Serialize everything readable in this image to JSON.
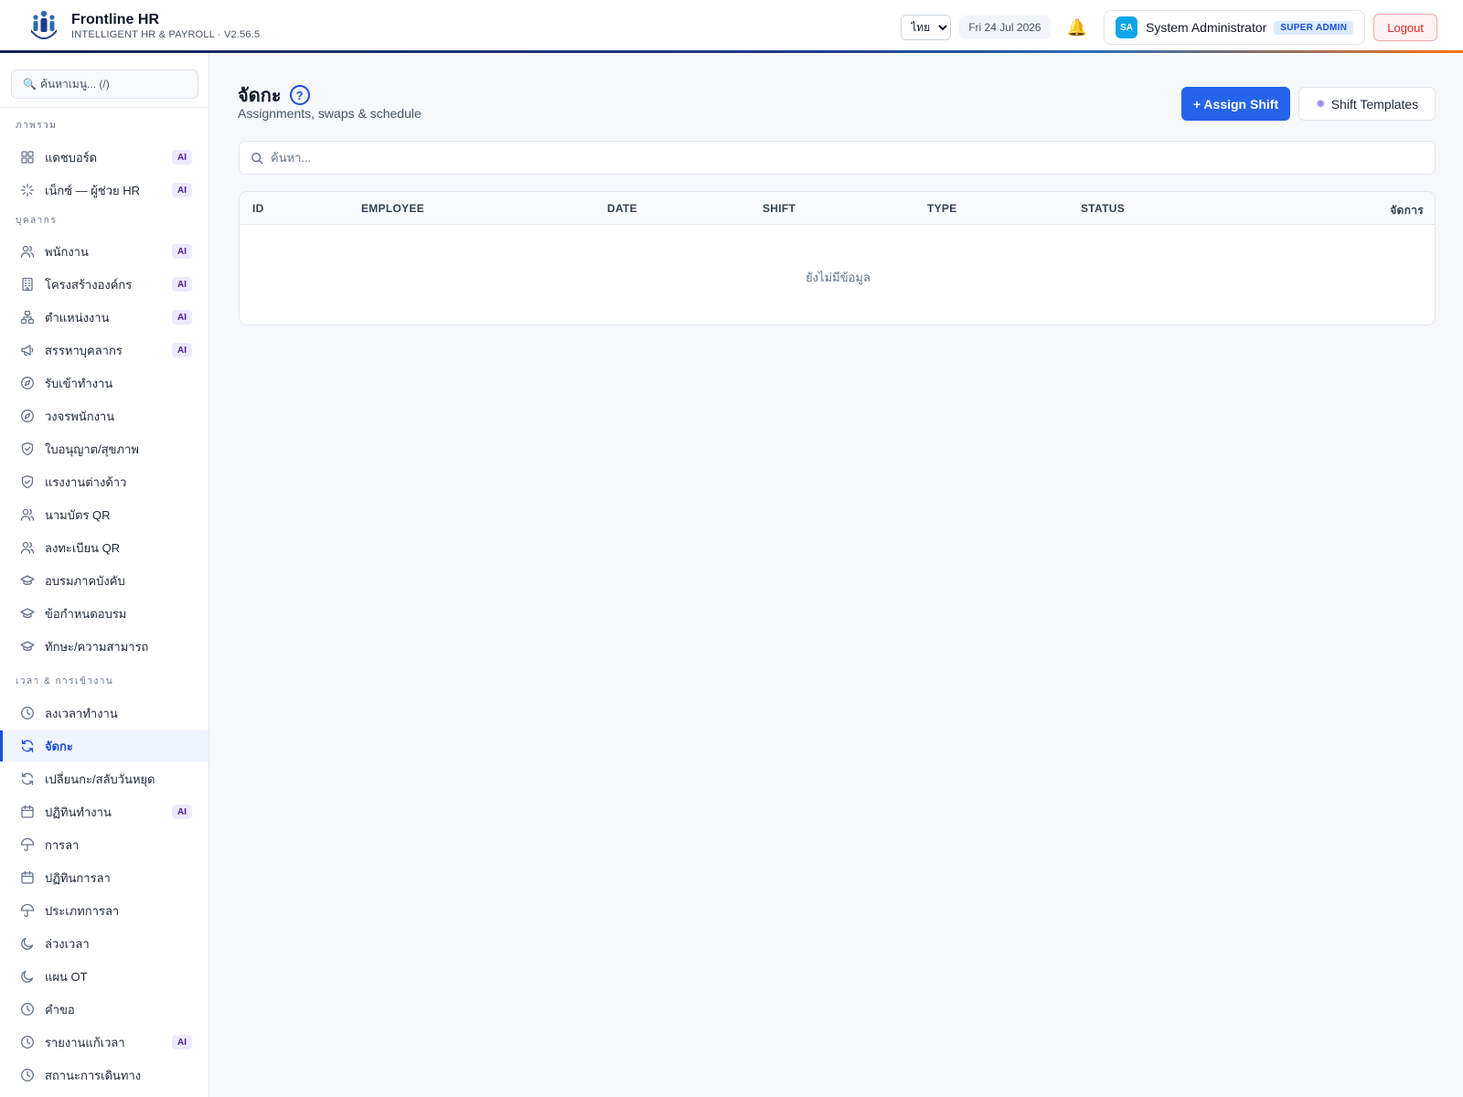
{
  "header": {
    "app_name": "Frontline HR",
    "app_sub": "INTELLIGENT HR & PAYROLL · V2.56.5",
    "language": "ไทย",
    "date": "Fri 24 Jul 2026",
    "user_initials": "SA",
    "user_name": "System Administrator",
    "role": "SUPER ADMIN",
    "logout_label": "Logout"
  },
  "sidebar": {
    "search_placeholder": "ค้นหาเมนู... (/)",
    "groups": [
      "ภาพรวม",
      "บุคลากร",
      "เวลา & การเข้างาน"
    ],
    "ai_label": "AI",
    "items": [
      {
        "label": "แดชบอร์ด",
        "icon": "grid-icon",
        "ai": true
      },
      {
        "label": "เน็กซ์ — ผู้ช่วย HR",
        "icon": "sparkle-icon",
        "ai": true
      },
      {
        "label": "พนักงาน",
        "icon": "users-icon",
        "ai": true
      },
      {
        "label": "โครงสร้างองค์กร",
        "icon": "building-icon",
        "ai": true
      },
      {
        "label": "ตำแหน่งงาน",
        "icon": "org-chart-icon",
        "ai": true
      },
      {
        "label": "สรรหาบุคลากร",
        "icon": "megaphone-icon",
        "ai": true
      },
      {
        "label": "รับเข้าทำงาน",
        "icon": "compass-icon",
        "ai": false
      },
      {
        "label": "วงจรพนักงาน",
        "icon": "compass-icon",
        "ai": false
      },
      {
        "label": "ใบอนุญาต/สุขภาพ",
        "icon": "shield-check-icon",
        "ai": false
      },
      {
        "label": "แรงงานต่างด้าว",
        "icon": "shield-check-icon",
        "ai": false
      },
      {
        "label": "นามบัตร QR",
        "icon": "users-icon",
        "ai": false
      },
      {
        "label": "ลงทะเบียน QR",
        "icon": "users-icon",
        "ai": false
      },
      {
        "label": "อบรมภาคบังคับ",
        "icon": "graduation-cap-icon",
        "ai": false
      },
      {
        "label": "ข้อกำหนดอบรม",
        "icon": "graduation-cap-icon",
        "ai": false
      },
      {
        "label": "ทักษะ/ความสามารถ",
        "icon": "graduation-cap-icon",
        "ai": false
      },
      {
        "label": "ลงเวลาทำงาน",
        "icon": "clock-icon",
        "ai": false
      },
      {
        "label": "จัดกะ",
        "icon": "refresh-icon",
        "ai": false
      },
      {
        "label": "เปลี่ยนกะ/สลับวันหยุด",
        "icon": "refresh-icon",
        "ai": false
      },
      {
        "label": "ปฏิทินทำงาน",
        "icon": "calendar-icon",
        "ai": true
      },
      {
        "label": "การลา",
        "icon": "umbrella-icon",
        "ai": false
      },
      {
        "label": "ปฏิทินการลา",
        "icon": "calendar-icon",
        "ai": false
      },
      {
        "label": "ประเภทการลา",
        "icon": "umbrella-icon",
        "ai": false
      },
      {
        "label": "ล่วงเวลา",
        "icon": "moon-icon",
        "ai": false
      },
      {
        "label": "แผน OT",
        "icon": "moon-icon",
        "ai": false
      },
      {
        "label": "คำขอ",
        "icon": "clock-icon",
        "ai": false
      },
      {
        "label": "รายงานแก้เวลา",
        "icon": "clock-icon",
        "ai": true
      },
      {
        "label": "สถานะการเดินทาง",
        "icon": "clock-icon",
        "ai": false
      }
    ]
  },
  "main": {
    "title": "จัดกะ",
    "help": "?",
    "subtitle": "Assignments, swaps & schedule",
    "assign_label": "+ Assign Shift",
    "templates_label": "Shift Templates",
    "search_placeholder": "ค้นหา...",
    "columns": [
      "ID",
      "EMPLOYEE",
      "DATE",
      "SHIFT",
      "TYPE",
      "STATUS",
      "จัดการ"
    ],
    "empty": "ยังไม่มีข้อมูล"
  },
  "colors": {
    "primary": "#2563eb",
    "active_nav": "#1d4ed8",
    "ai_badge": "#ede9fe",
    "logout": "#dc2626"
  }
}
